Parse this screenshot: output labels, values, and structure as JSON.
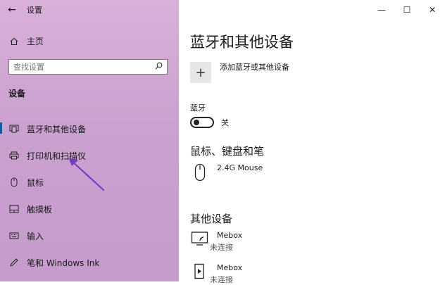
{
  "sidebar": {
    "back_glyph": "←",
    "app_title": "设置",
    "home_label": "主页",
    "search_placeholder": "查找设置",
    "section_label": "设备",
    "items": [
      {
        "label": "蓝牙和其他设备",
        "icon": "bluetooth-devices-icon",
        "active": true
      },
      {
        "label": "打印机和扫描仪",
        "icon": "printer-icon"
      },
      {
        "label": "鼠标",
        "icon": "mouse-icon"
      },
      {
        "label": "触摸板",
        "icon": "touchpad-icon"
      },
      {
        "label": "输入",
        "icon": "keyboard-icon"
      },
      {
        "label": "笔和 Windows Ink",
        "icon": "pen-icon"
      }
    ]
  },
  "window_controls": {
    "minimize": "—",
    "maximize": "☐",
    "close": "✕"
  },
  "main": {
    "page_title": "蓝牙和其他设备",
    "add_device_label": "添加蓝牙或其他设备",
    "bluetooth_label": "蓝牙",
    "bluetooth_state": "关",
    "mouse_section_title": "鼠标、键盘和笔",
    "mouse_device_name": "2.4G Mouse",
    "other_section_title": "其他设备",
    "other_devices": [
      {
        "name": "Mebox",
        "status": "未连接",
        "icon": "display-device-icon"
      },
      {
        "name": "Mebox",
        "status": "未连接",
        "icon": "media-device-icon"
      }
    ]
  },
  "colors": {
    "sidebar_top": "#d8b0d8",
    "sidebar_bottom": "#c59bcc",
    "accent": "#1a56a8",
    "annotation_arrow": "#7a3cc8"
  }
}
